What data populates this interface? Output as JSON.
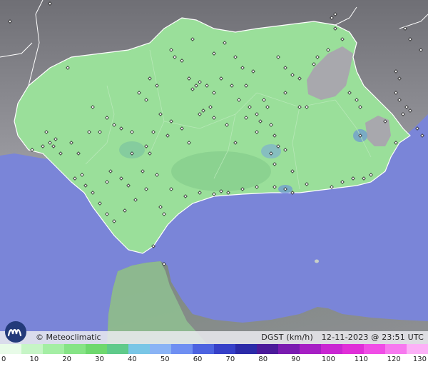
{
  "credit": "© Meteoclimatic",
  "variable": "DGST (km/h)",
  "timestamp": "12-11-2023 @ 23:51 UTC",
  "legend": {
    "ticks": [
      "0",
      "10",
      "20",
      "30",
      "40",
      "50",
      "60",
      "70",
      "80",
      "90",
      "100",
      "110",
      "120",
      "130"
    ],
    "colors": [
      "#e8fbe8",
      "#c6f5c6",
      "#a4eea4",
      "#86e486",
      "#6ed86e",
      "#5fca8a",
      "#79c6e6",
      "#8ab3f5",
      "#6f8ff2",
      "#4c63e0",
      "#3640c8",
      "#2b2aa8",
      "#4b1a9a",
      "#7a1bb0",
      "#a61fc4",
      "#c926d2",
      "#e02fd8",
      "#f04de6",
      "#f779ef",
      "#fcb1f7"
    ]
  },
  "colors": {
    "sea": "#7a85d8",
    "land_other": "#8a8a90",
    "land_region": "#9adf9a",
    "border": "#ffffff"
  }
}
